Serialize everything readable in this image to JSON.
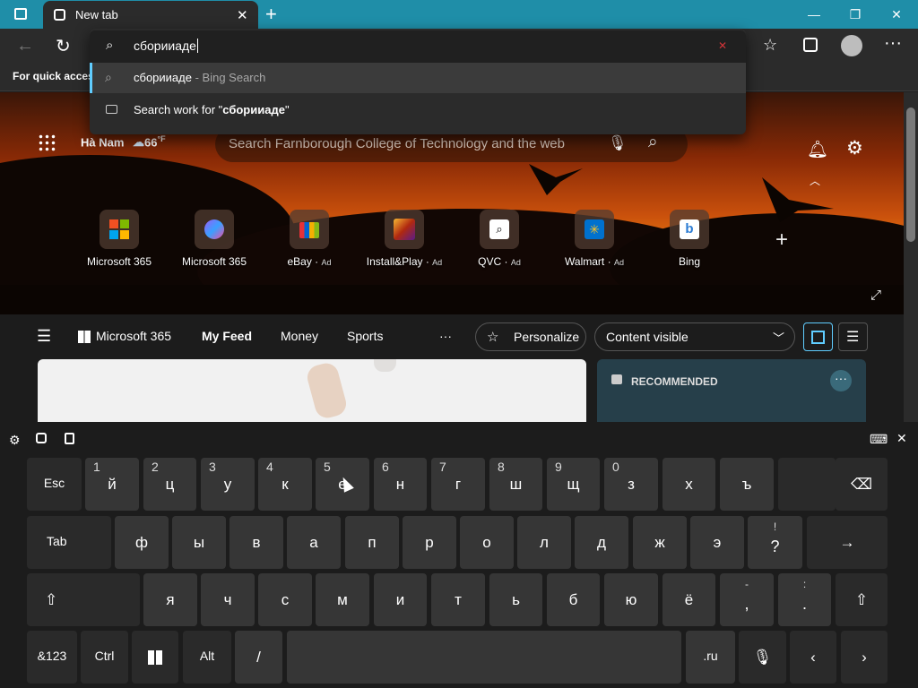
{
  "browser": {
    "tab_title": "New tab",
    "favorites_bar_text": "For quick access",
    "address_value": "сборииаде",
    "suggestions": [
      {
        "text": "сборииаде",
        "suffix": " - Bing Search"
      },
      {
        "prefix": "Search work for \"",
        "bold": "сборииаде",
        "suffix": "\""
      }
    ]
  },
  "newtab": {
    "location": "Hà Nam",
    "temperature": "66",
    "temp_unit": "°F",
    "search_placeholder": "Search Farnborough College of Technology and the web",
    "tiles": [
      {
        "label": "Microsoft 365",
        "ad": ""
      },
      {
        "label": "Microsoft 365",
        "ad": ""
      },
      {
        "label": "eBay",
        "ad": "Ad"
      },
      {
        "label": "Install&Play",
        "ad": "Ad"
      },
      {
        "label": "QVC",
        "ad": "Ad"
      },
      {
        "label": "Walmart",
        "ad": "Ad"
      },
      {
        "label": "Bing",
        "ad": ""
      }
    ],
    "nav": {
      "brand": "Microsoft 365",
      "my_feed": "My Feed",
      "money": "Money",
      "sports": "Sports",
      "more": "···",
      "personalize": "Personalize",
      "content_visible": "Content visible"
    },
    "recommended": "RECOMMENDED"
  },
  "keyboard": {
    "row1": [
      {
        "main": "Esc",
        "sub": ""
      },
      {
        "main": "й",
        "sub": "1"
      },
      {
        "main": "ц",
        "sub": "2"
      },
      {
        "main": "у",
        "sub": "3"
      },
      {
        "main": "к",
        "sub": "4"
      },
      {
        "main": "е",
        "sub": "5"
      },
      {
        "main": "н",
        "sub": "6"
      },
      {
        "main": "г",
        "sub": "7"
      },
      {
        "main": "ш",
        "sub": "8"
      },
      {
        "main": "щ",
        "sub": "9"
      },
      {
        "main": "з",
        "sub": "0"
      },
      {
        "main": "х",
        "sub": ""
      },
      {
        "main": "ъ",
        "sub": ""
      },
      {
        "main": "",
        "sub": ""
      },
      {
        "main": "⌫",
        "sub": ""
      }
    ],
    "row2": [
      {
        "main": "Tab"
      },
      {
        "main": "ф"
      },
      {
        "main": "ы"
      },
      {
        "main": "в"
      },
      {
        "main": "а"
      },
      {
        "main": "п"
      },
      {
        "main": "р"
      },
      {
        "main": "о"
      },
      {
        "main": "л"
      },
      {
        "main": "д"
      },
      {
        "main": "ж"
      },
      {
        "main": "э"
      },
      {
        "top": "!",
        "bottom": "?"
      },
      {
        "main": "→"
      }
    ],
    "row3": [
      {
        "main": "⇧"
      },
      {
        "main": "я"
      },
      {
        "main": "ч"
      },
      {
        "main": "с"
      },
      {
        "main": "м"
      },
      {
        "main": "и"
      },
      {
        "main": "т"
      },
      {
        "main": "ь"
      },
      {
        "main": "б"
      },
      {
        "main": "ю"
      },
      {
        "main": "ё"
      },
      {
        "top": "-",
        "bottom": ","
      },
      {
        "top": ":",
        "bottom": "."
      },
      {
        "main": "⇧"
      }
    ],
    "row4": [
      {
        "main": "&123"
      },
      {
        "main": "Ctrl"
      },
      {
        "main": ""
      },
      {
        "main": "Alt"
      },
      {
        "main": "/"
      },
      {
        "main": ""
      },
      {
        "main": ".ru"
      },
      {
        "main": ""
      },
      {
        "main": "‹"
      },
      {
        "main": "›"
      }
    ]
  }
}
